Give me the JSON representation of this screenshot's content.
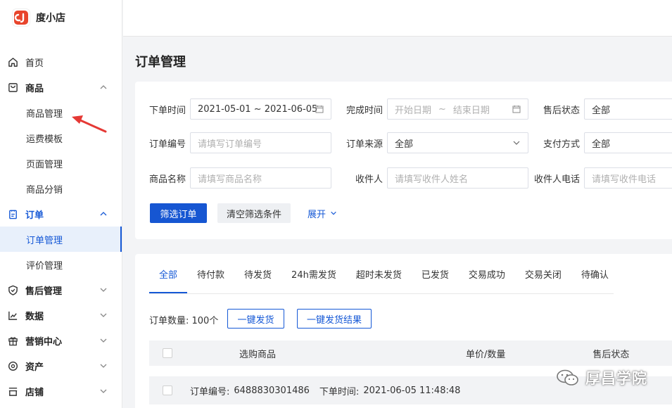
{
  "app": {
    "name": "度小店"
  },
  "sidebar": {
    "items": [
      {
        "label": "首页",
        "icon": "home-icon"
      },
      {
        "label": "商品",
        "icon": "bag-icon"
      },
      {
        "label": "商品管理"
      },
      {
        "label": "运费模板"
      },
      {
        "label": "页面管理"
      },
      {
        "label": "商品分销"
      },
      {
        "label": "订单",
        "icon": "clipboard-icon"
      },
      {
        "label": "订单管理"
      },
      {
        "label": "评价管理"
      },
      {
        "label": "售后管理",
        "icon": "shield-icon"
      },
      {
        "label": "数据",
        "icon": "chart-icon"
      },
      {
        "label": "营销中心",
        "icon": "gift-icon"
      },
      {
        "label": "资产",
        "icon": "coin-icon"
      },
      {
        "label": "店铺",
        "icon": "store-icon"
      }
    ]
  },
  "page": {
    "title": "订单管理"
  },
  "filters": {
    "order_time": {
      "label": "下单时间",
      "value": "2021-05-01 ~ 2021-06-05"
    },
    "finish_time": {
      "label": "完成时间",
      "start_placeholder": "开始日期",
      "sep": "~",
      "end_placeholder": "结束日期"
    },
    "aftersale_status": {
      "label": "售后状态",
      "value": "全部"
    },
    "order_no": {
      "label": "订单编号",
      "placeholder": "请填写订单编号"
    },
    "order_source": {
      "label": "订单来源",
      "value": "全部"
    },
    "pay_method": {
      "label": "支付方式",
      "value": "全部"
    },
    "product_name": {
      "label": "商品名称",
      "placeholder": "请填写商品名称"
    },
    "receiver": {
      "label": "收件人",
      "placeholder": "请填写收件人姓名"
    },
    "receiver_phone": {
      "label": "收件人电话",
      "placeholder": "请填写收件电话"
    },
    "filter_button": "筛选订单",
    "clear_button": "清空筛选条件",
    "expand_link": "展开"
  },
  "orders": {
    "tabs": [
      "全部",
      "待付款",
      "待发货",
      "24h需发货",
      "超时未发货",
      "已发货",
      "交易成功",
      "交易关闭",
      "待确认"
    ],
    "count_text": "订单数量: 100个",
    "ship_button": "一键发货",
    "ship_result_button": "一键发货结果",
    "columns": [
      "选购商品",
      "单价/数量",
      "售后状态"
    ],
    "first_row": {
      "order_no_label": "订单编号:",
      "order_no": "6488830301486",
      "order_time_label": "下单时间:",
      "order_time": "2021-06-05 11:48:48"
    }
  },
  "watermark": {
    "text": "厚昌学院"
  },
  "colors": {
    "accent": "#1558d6",
    "logo": "#e8452c"
  }
}
